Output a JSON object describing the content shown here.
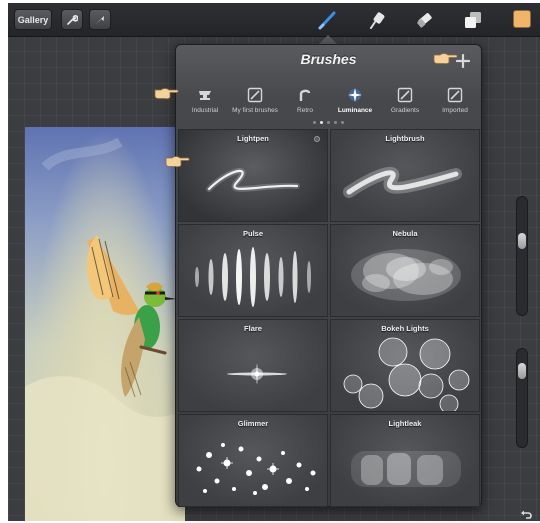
{
  "toolbar": {
    "gallery_label": "Gallery",
    "tools": [
      "wrench-icon",
      "transform-arrow-icon",
      "brush-icon",
      "smudge-icon",
      "eraser-icon",
      "layers-icon"
    ],
    "active_tool": "brush-icon",
    "color": "#f0b56b"
  },
  "panel": {
    "title": "Brushes",
    "add_icon": "plus-icon",
    "categories": [
      {
        "label": "Industrial",
        "icon": "anvil-icon"
      },
      {
        "label": "My first brushes",
        "icon": "pencil-square-icon"
      },
      {
        "label": "Retro",
        "icon": "retro-icon"
      },
      {
        "label": "Luminance",
        "icon": "sparkle-icon"
      },
      {
        "label": "Gradients",
        "icon": "pencil-square-icon"
      },
      {
        "label": "Imported",
        "icon": "pencil-square-icon"
      }
    ],
    "active_category": "Luminance",
    "page_count": 5,
    "active_page": 2,
    "brushes": [
      {
        "name": "Lightpen",
        "selected": true
      },
      {
        "name": "Lightbrush",
        "selected": false
      },
      {
        "name": "Pulse",
        "selected": false
      },
      {
        "name": "Nebula",
        "selected": false
      },
      {
        "name": "Flare",
        "selected": false
      },
      {
        "name": "Bokeh Lights",
        "selected": false
      },
      {
        "name": "Glimmer",
        "selected": false
      },
      {
        "name": "Lightleak",
        "selected": false
      }
    ]
  },
  "accent": {
    "active_blue": "#3b8fe8",
    "panel": "#47484c",
    "pointer_hand": "#f3d29c"
  }
}
